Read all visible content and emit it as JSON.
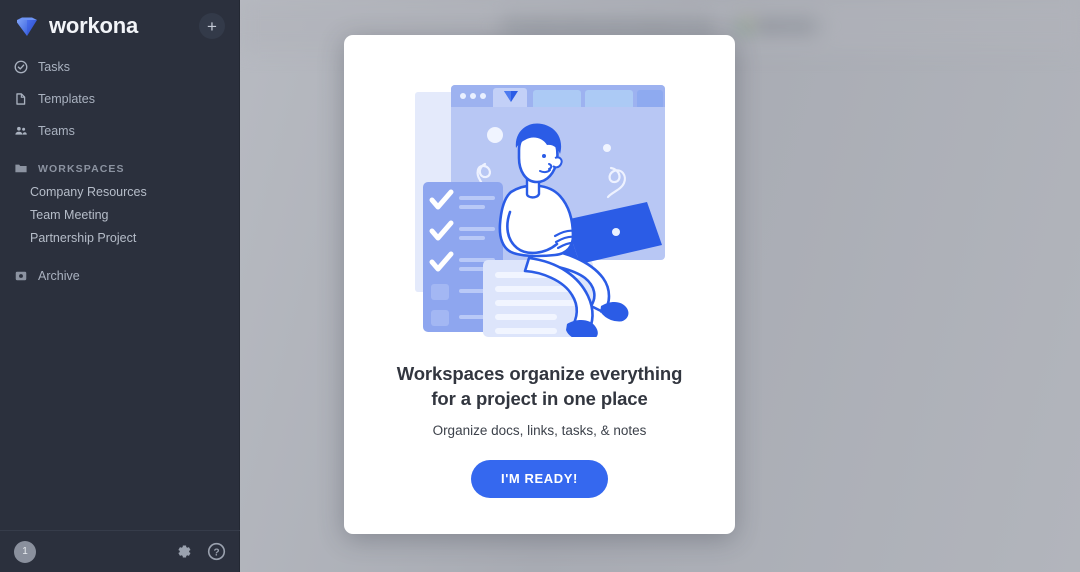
{
  "app": {
    "brand_name": "workona",
    "accent_blue": "#3568ef",
    "sidebar_bg": "#2b303d",
    "illustration_blue": "#2b5ce6",
    "illustration_light": "#a8b8f2"
  },
  "sidebar": {
    "add_button_label": "+",
    "nav_items": [
      {
        "label": "Tasks",
        "icon": "check-circle-icon"
      },
      {
        "label": "Templates",
        "icon": "document-icon"
      },
      {
        "label": "Teams",
        "icon": "people-icon"
      }
    ],
    "workspaces_section": {
      "label": "WORKSPACES",
      "icon": "folder-icon",
      "items": [
        {
          "label": "Company Resources"
        },
        {
          "label": "Team Meeting"
        },
        {
          "label": "Partnership Project"
        }
      ]
    },
    "archive": {
      "label": "Archive",
      "icon": "archive-icon"
    },
    "footer": {
      "avatar_label": "1",
      "settings_icon": "gear-icon",
      "help_icon": "help-circle-icon"
    }
  },
  "background": {
    "search": {
      "placeholder": "Search Chrome, Drive, Workona, & more",
      "icon": "search-icon"
    },
    "new_doc": {
      "label": "NEW DOC",
      "icon": "google-drive-icon"
    },
    "faded_text": "tarted"
  },
  "modal": {
    "illustration": "person-with-laptop-illustration",
    "title_line1": "Workspaces organize everything",
    "title_line2": "for a project in one place",
    "subtitle": "Organize docs, links, tasks, & notes",
    "cta_label": "I'M READY!"
  }
}
